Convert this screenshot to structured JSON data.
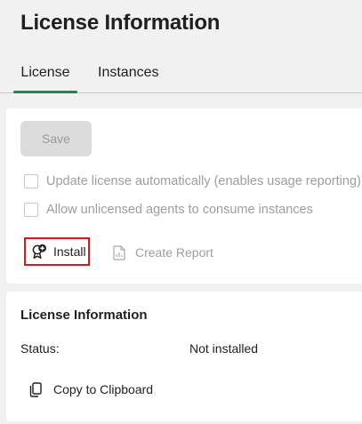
{
  "page": {
    "title": "License Information"
  },
  "tabs": [
    {
      "label": "License",
      "active": true
    },
    {
      "label": "Instances",
      "active": false
    }
  ],
  "settings": {
    "save_label": "Save",
    "checkboxes": [
      {
        "label": "Update license automatically (enables usage reporting)",
        "checked": false
      },
      {
        "label": "Allow unlicensed agents to consume instances",
        "checked": false
      }
    ],
    "actions": {
      "install_label": "Install",
      "install_icon": "certificate-add-icon",
      "report_label": "Create Report",
      "report_icon": "report-document-icon"
    }
  },
  "info": {
    "title": "License Information",
    "status_label": "Status:",
    "status_value": "Not installed",
    "copy_label": "Copy to Clipboard",
    "copy_icon": "copy-icon"
  },
  "colors": {
    "accent": "#2e7d4a",
    "highlight_border": "#e0141e",
    "disabled_text": "#9e9e9e"
  }
}
